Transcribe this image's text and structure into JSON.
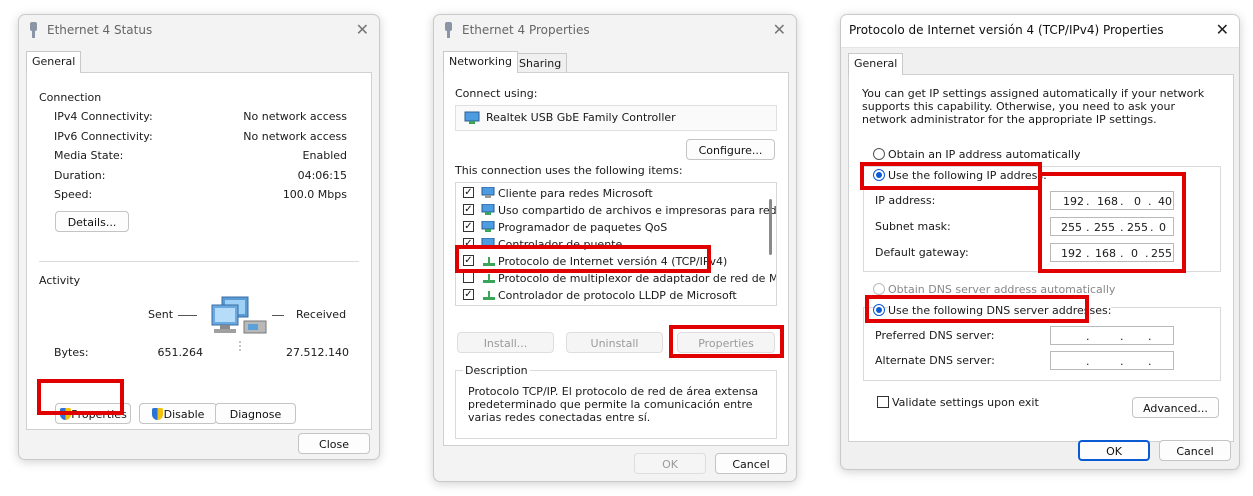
{
  "status_window": {
    "title": "Ethernet 4 Status",
    "tab_general": "General",
    "connection_header": "Connection",
    "rows": [
      {
        "label": "IPv4 Connectivity:",
        "value": "No network access"
      },
      {
        "label": "IPv6 Connectivity:",
        "value": "No network access"
      },
      {
        "label": "Media State:",
        "value": "Enabled"
      },
      {
        "label": "Duration:",
        "value": "04:06:15"
      },
      {
        "label": "Speed:",
        "value": "100.0 Mbps"
      }
    ],
    "details_button": "Details...",
    "activity_header": "Activity",
    "sent_label": "Sent",
    "received_label": "Received",
    "bytes_label": "Bytes:",
    "bytes_sent": "651.264",
    "bytes_received": "27.512.140",
    "properties_button": "Properties",
    "disable_button": "Disable",
    "diagnose_button": "Diagnose",
    "close_button": "Close"
  },
  "properties_window": {
    "title": "Ethernet 4 Properties",
    "tab_networking": "Networking",
    "tab_sharing": "Sharing",
    "connect_using_label": "Connect using:",
    "adapter_name": "Realtek USB GbE Family Controller",
    "configure_button": "Configure...",
    "items_label": "This connection uses the following items:",
    "items": [
      {
        "label": "Cliente para redes Microsoft",
        "checked": true
      },
      {
        "label": "Uso compartido de archivos e impresoras para redes M",
        "checked": true
      },
      {
        "label": "Programador de paquetes QoS",
        "checked": true
      },
      {
        "label": "Controlador de puente",
        "checked": true
      },
      {
        "label": "Protocolo de Internet versión 4 (TCP/IPv4)",
        "checked": true
      },
      {
        "label": "Protocolo de multiplexor de adaptador de red de Micros",
        "checked": false
      },
      {
        "label": "Controlador de protocolo LLDP de Microsoft",
        "checked": true
      }
    ],
    "install_button": "Install...",
    "uninstall_button": "Uninstall",
    "properties_button": "Properties",
    "description_header": "Description",
    "description_text": "Protocolo TCP/IP. El protocolo de red de área extensa predeterminado que permite la comunicación entre varias redes conectadas entre sí.",
    "ok_button": "OK",
    "cancel_button": "Cancel"
  },
  "ipv4_window": {
    "title": "Protocolo de Internet versión 4 (TCP/IPv4) Properties",
    "tab_general": "General",
    "intro_text": "You can get IP settings assigned automatically if your network supports this capability. Otherwise, you need to ask your network administrator for the appropriate IP settings.",
    "obtain_ip_auto": "Obtain an IP address automatically",
    "use_following_ip": "Use the following IP address:",
    "ip_address_label": "IP address:",
    "ip_address": [
      "192",
      "168",
      "0",
      "40"
    ],
    "subnet_mask_label": "Subnet mask:",
    "subnet_mask": [
      "255",
      "255",
      "255",
      "0"
    ],
    "gateway_label": "Default gateway:",
    "gateway": [
      "192",
      "168",
      "0",
      "255"
    ],
    "obtain_dns_auto": "Obtain DNS server address automatically",
    "use_following_dns": "Use the following DNS server addresses:",
    "preferred_dns_label": "Preferred DNS server:",
    "alternate_dns_label": "Alternate DNS server:",
    "validate_label": "Validate settings upon exit",
    "advanced_button": "Advanced...",
    "ok_button": "OK",
    "cancel_button": "Cancel"
  },
  "colors": {
    "highlight_red": "#e00000",
    "radio_blue": "#0a5ad4"
  }
}
